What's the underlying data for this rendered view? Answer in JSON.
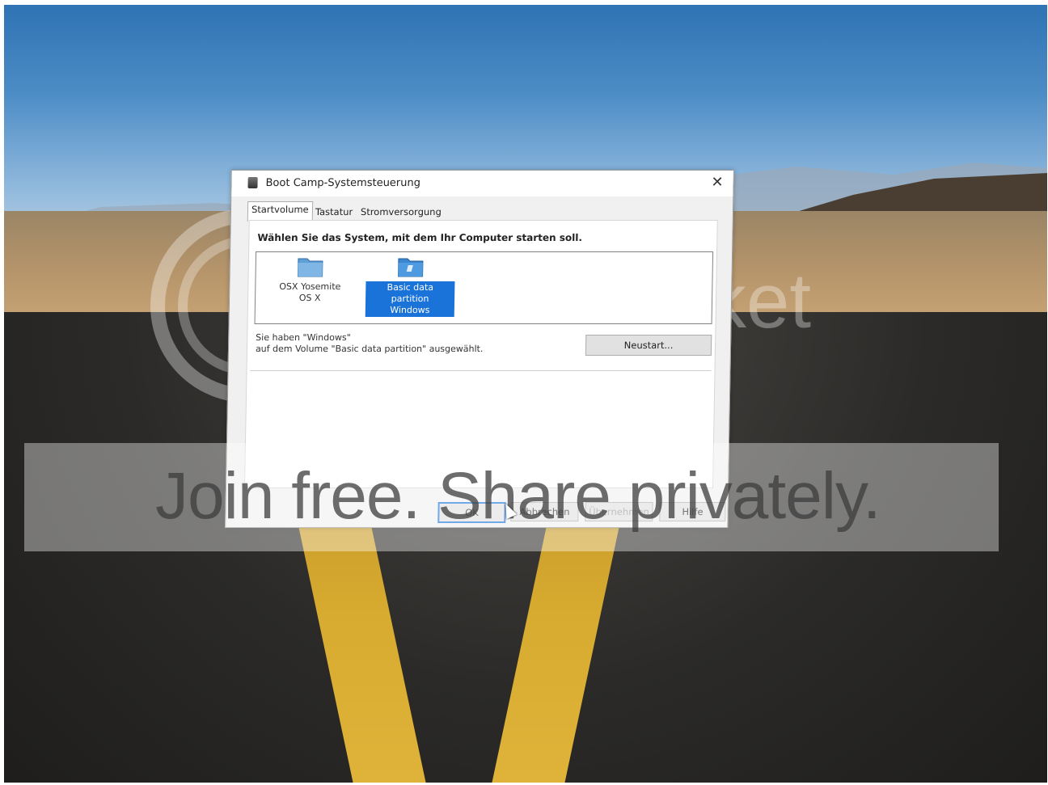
{
  "window": {
    "title": "Boot Camp-Systemsteuerung",
    "close_glyph": "✕"
  },
  "tabs": [
    {
      "label": "Startvolume",
      "active": true
    },
    {
      "label": "Tastatur",
      "active": false
    },
    {
      "label": "Stromversorgung",
      "active": false
    }
  ],
  "panel": {
    "heading": "Wählen Sie das System, mit dem Ihr Computer starten soll.",
    "volumes": [
      {
        "line1": "OSX Yosemite",
        "line2": "OS X",
        "icon": "folder-icon",
        "selected": false
      },
      {
        "line1": "Basic data partition",
        "line2": "Windows",
        "icon": "folder-icon",
        "selected": true
      }
    ],
    "info_line1": "Sie haben \"Windows\"",
    "info_line2": "auf dem Volume \"Basic data partition\" ausgewählt.",
    "restart_label": "Neustart..."
  },
  "footer": {
    "ok_label": "OK",
    "cancel_label": "Abbrechen",
    "apply_label": "Übernehmen",
    "help_label": "Hilfe"
  },
  "watermark": {
    "brand": "photobucket",
    "slogan": "Join free. Share privately."
  },
  "colors": {
    "selection": "#1a73d8",
    "dialog_bg": "#f0f0f0"
  }
}
